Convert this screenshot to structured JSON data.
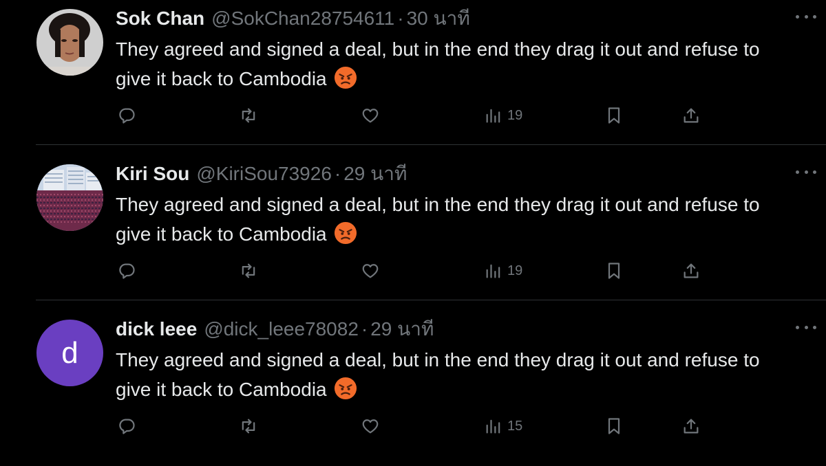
{
  "tweets": [
    {
      "name": "Sok Chan",
      "handle": "@SokChan28754611",
      "separator": "·",
      "time": "30 นาที",
      "text": "They agreed and signed a deal, but in the end they drag it out and refuse to give it back to Cambodia",
      "emoji": "angry-face",
      "views": "19",
      "avatar": {
        "type": "photo",
        "subject": "portrait"
      }
    },
    {
      "name": "Kiri Sou",
      "handle": "@KiriSou73926",
      "separator": "·",
      "time": "29 นาที",
      "text": "They agreed and signed a deal, but in the end they drag it out and refuse to give it back to Cambodia",
      "emoji": "angry-face",
      "views": "19",
      "avatar": {
        "type": "photo",
        "subject": "crowd"
      }
    },
    {
      "name": "dick leee",
      "handle": "@dick_leee78082",
      "separator": "·",
      "time": "29 นาที",
      "text": "They agreed and signed a deal, but in the end they drag it out and refuse to give it back to Cambodia",
      "emoji": "angry-face",
      "views": "15",
      "avatar": {
        "type": "letter",
        "letter": "d",
        "color": "#6a3fc1"
      }
    }
  ],
  "colors": {
    "background": "#000000",
    "primary_text": "#e7e9ea",
    "secondary_text": "#71767b",
    "divider": "#2f3336"
  },
  "icons": [
    "reply-icon",
    "retweet-icon",
    "like-icon",
    "views-icon",
    "bookmark-icon",
    "share-icon",
    "more-icon"
  ]
}
